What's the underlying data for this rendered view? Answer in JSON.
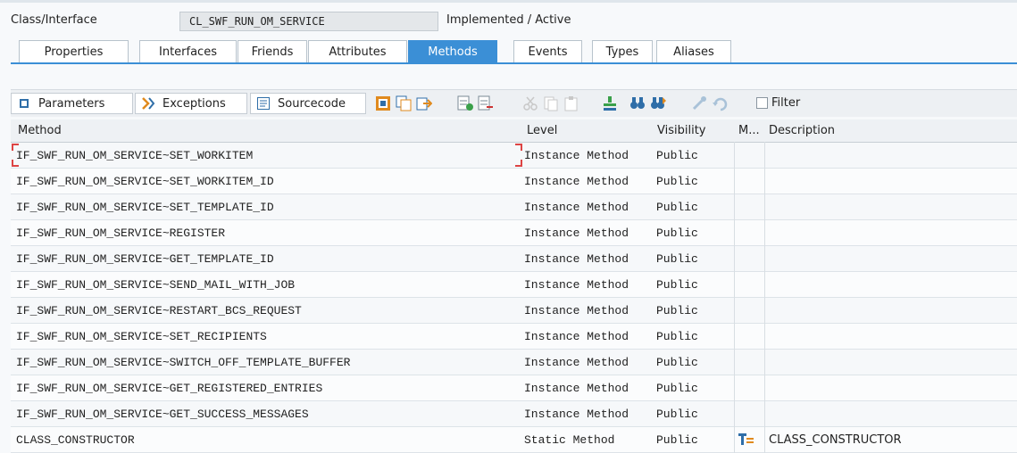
{
  "header": {
    "label": "Class/Interface",
    "class_name": "CL_SWF_RUN_OM_SERVICE",
    "status": "Implemented / Active"
  },
  "tabs": [
    {
      "label": "Properties"
    },
    {
      "label": "Interfaces"
    },
    {
      "label": "Friends"
    },
    {
      "label": "Attributes"
    },
    {
      "label": "Methods",
      "active": true
    },
    {
      "label": "Events"
    },
    {
      "label": "Types"
    },
    {
      "label": "Aliases"
    }
  ],
  "toolbar": {
    "parameters_label": "Parameters",
    "exceptions_label": "Exceptions",
    "sourcecode_label": "Sourcecode",
    "filter_label": "Filter"
  },
  "columns": {
    "method": "Method",
    "level": "Level",
    "visibility": "Visibility",
    "m": "M...",
    "description": "Description"
  },
  "rows": [
    {
      "method": "IF_SWF_RUN_OM_SERVICE~SET_WORKITEM",
      "level": "Instance Method",
      "visibility": "Public",
      "description": ""
    },
    {
      "method": "IF_SWF_RUN_OM_SERVICE~SET_WORKITEM_ID",
      "level": "Instance Method",
      "visibility": "Public",
      "description": ""
    },
    {
      "method": "IF_SWF_RUN_OM_SERVICE~SET_TEMPLATE_ID",
      "level": "Instance Method",
      "visibility": "Public",
      "description": ""
    },
    {
      "method": "IF_SWF_RUN_OM_SERVICE~REGISTER",
      "level": "Instance Method",
      "visibility": "Public",
      "description": ""
    },
    {
      "method": "IF_SWF_RUN_OM_SERVICE~GET_TEMPLATE_ID",
      "level": "Instance Method",
      "visibility": "Public",
      "description": ""
    },
    {
      "method": "IF_SWF_RUN_OM_SERVICE~SEND_MAIL_WITH_JOB",
      "level": "Instance Method",
      "visibility": "Public",
      "description": ""
    },
    {
      "method": "IF_SWF_RUN_OM_SERVICE~RESTART_BCS_REQUEST",
      "level": "Instance Method",
      "visibility": "Public",
      "description": ""
    },
    {
      "method": "IF_SWF_RUN_OM_SERVICE~SET_RECIPIENTS",
      "level": "Instance Method",
      "visibility": "Public",
      "description": ""
    },
    {
      "method": "IF_SWF_RUN_OM_SERVICE~SWITCH_OFF_TEMPLATE_BUFFER",
      "level": "Instance Method",
      "visibility": "Public",
      "description": ""
    },
    {
      "method": "IF_SWF_RUN_OM_SERVICE~GET_REGISTERED_ENTRIES",
      "level": "Instance Method",
      "visibility": "Public",
      "description": ""
    },
    {
      "method": "IF_SWF_RUN_OM_SERVICE~GET_SUCCESS_MESSAGES",
      "level": "Instance Method",
      "visibility": "Public",
      "description": ""
    },
    {
      "method": "CLASS_CONSTRUCTOR",
      "level": "Static Method",
      "visibility": "Public",
      "description": "CLASS_CONSTRUCTOR",
      "m_icon": "class-constructor-icon"
    }
  ],
  "colors": {
    "accent": "#3b8fd6",
    "icon_orange": "#e08a1e",
    "icon_green": "#3aa04a"
  }
}
